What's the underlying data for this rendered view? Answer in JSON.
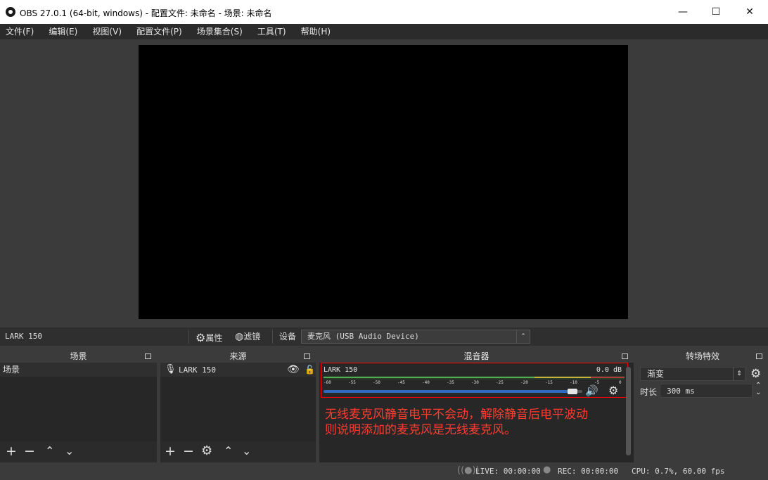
{
  "window": {
    "title": "OBS 27.0.1 (64-bit, windows) - 配置文件: 未命名 - 场景: 未命名",
    "minimize_glyph": "—",
    "maximize_glyph": "☐",
    "close_glyph": "✕"
  },
  "menu": [
    {
      "label": "文件(F)"
    },
    {
      "label": "编辑(E)"
    },
    {
      "label": "视图(V)"
    },
    {
      "label": "配置文件(P)"
    },
    {
      "label": "场景集合(S)"
    },
    {
      "label": "工具(T)"
    },
    {
      "label": "帮助(H)"
    }
  ],
  "source_toolbar": {
    "source_name": "LARK 150",
    "properties_label": "属性",
    "filters_label": "滤镜",
    "device_label": "设备",
    "device_value": "麦克风 (USB Audio Device)"
  },
  "docks": {
    "scenes": {
      "title": "场景",
      "items": [
        {
          "label": "场景"
        }
      ]
    },
    "sources": {
      "title": "来源",
      "items": [
        {
          "label": "LARK 150"
        }
      ]
    },
    "mixer": {
      "title": "混音器",
      "channel_name": "LARK 150",
      "db_value": "0.0 dB",
      "scale_ticks": [
        "-60",
        "-55",
        "-50",
        "-45",
        "-40",
        "-35",
        "-30",
        "-25",
        "-20",
        "-15",
        "-10",
        "-5",
        "0"
      ],
      "volume_level": 0.98,
      "annotation_line1": "无线麦克风静音电平不会动，解除静音后电平波动",
      "annotation_line2": "则说明添加的麦克风是无线麦克风。"
    },
    "transitions": {
      "title": "转场特效",
      "transition_value": "渐变",
      "duration_label": "时长",
      "duration_value": "300 ms"
    }
  },
  "status": {
    "live": "LIVE: 00:00:00",
    "rec": "REC: 00:00:00",
    "cpu": "CPU: 0.7%, 60.00 fps"
  },
  "colors": {
    "accent_blue": "#2f6ac1",
    "meter_green": "#4caf50",
    "annotation_red": "#ff3b2f"
  }
}
